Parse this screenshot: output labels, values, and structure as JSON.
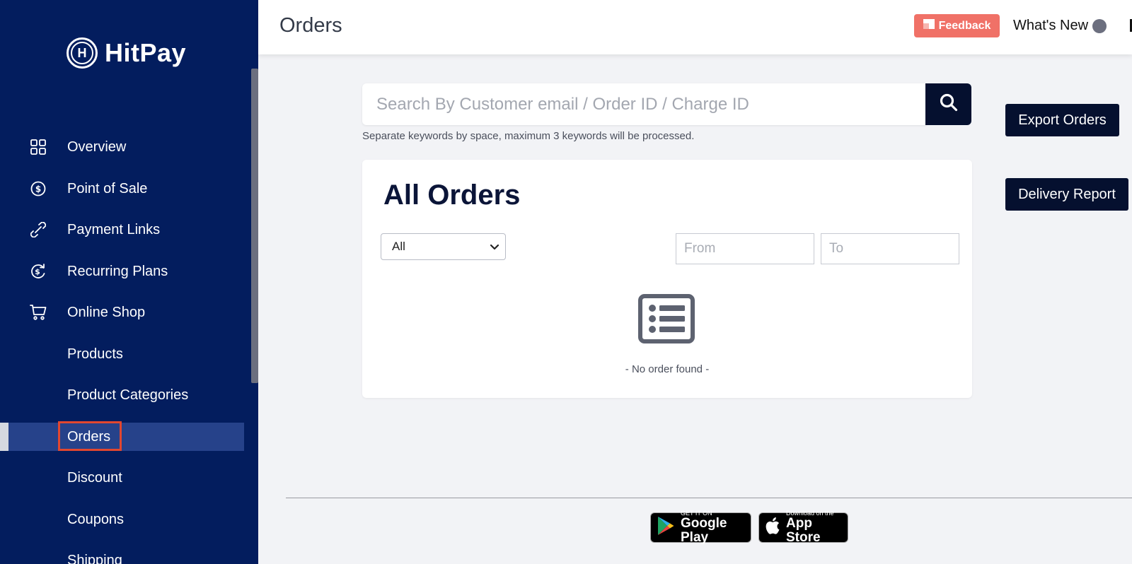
{
  "brand": {
    "name": "HitPay",
    "logo_letter": "H"
  },
  "sidebar": {
    "items": [
      {
        "label": "Overview",
        "icon": "grid-icon"
      },
      {
        "label": "Point of Sale",
        "icon": "dollar-circle-icon"
      },
      {
        "label": "Payment Links",
        "icon": "link-icon"
      },
      {
        "label": "Recurring Plans",
        "icon": "recurring-icon"
      },
      {
        "label": "Online Shop",
        "icon": "cart-icon"
      },
      {
        "label": "Products"
      },
      {
        "label": "Product Categories"
      },
      {
        "label": "Orders",
        "active": true
      },
      {
        "label": "Discount"
      },
      {
        "label": "Coupons"
      },
      {
        "label": "Shipping"
      }
    ]
  },
  "header": {
    "title": "Orders",
    "feedback_label": "Feedback",
    "whats_new_label": "What's New"
  },
  "search": {
    "placeholder": "Search By Customer email / Order ID / Charge ID",
    "value": "",
    "hint": "Separate keywords by space, maximum 3 keywords will be processed."
  },
  "actions": {
    "export_label": "Export Orders",
    "delivery_label": "Delivery Report"
  },
  "orders": {
    "title": "All Orders",
    "status_filter": {
      "selected": "All"
    },
    "from_placeholder": "From",
    "to_placeholder": "To",
    "empty_text": "- No order found -"
  },
  "footer": {
    "google_play": {
      "small": "GET IT ON",
      "big": "Google Play"
    },
    "app_store": {
      "small": "Download on the",
      "big": "App Store"
    }
  },
  "colors": {
    "sidebar_bg": "#031d5e",
    "active_item_bg": "#26428a",
    "feedback_bg": "#f07167",
    "dark_button_bg": "#05102f",
    "highlight_box": "#e2472f"
  }
}
